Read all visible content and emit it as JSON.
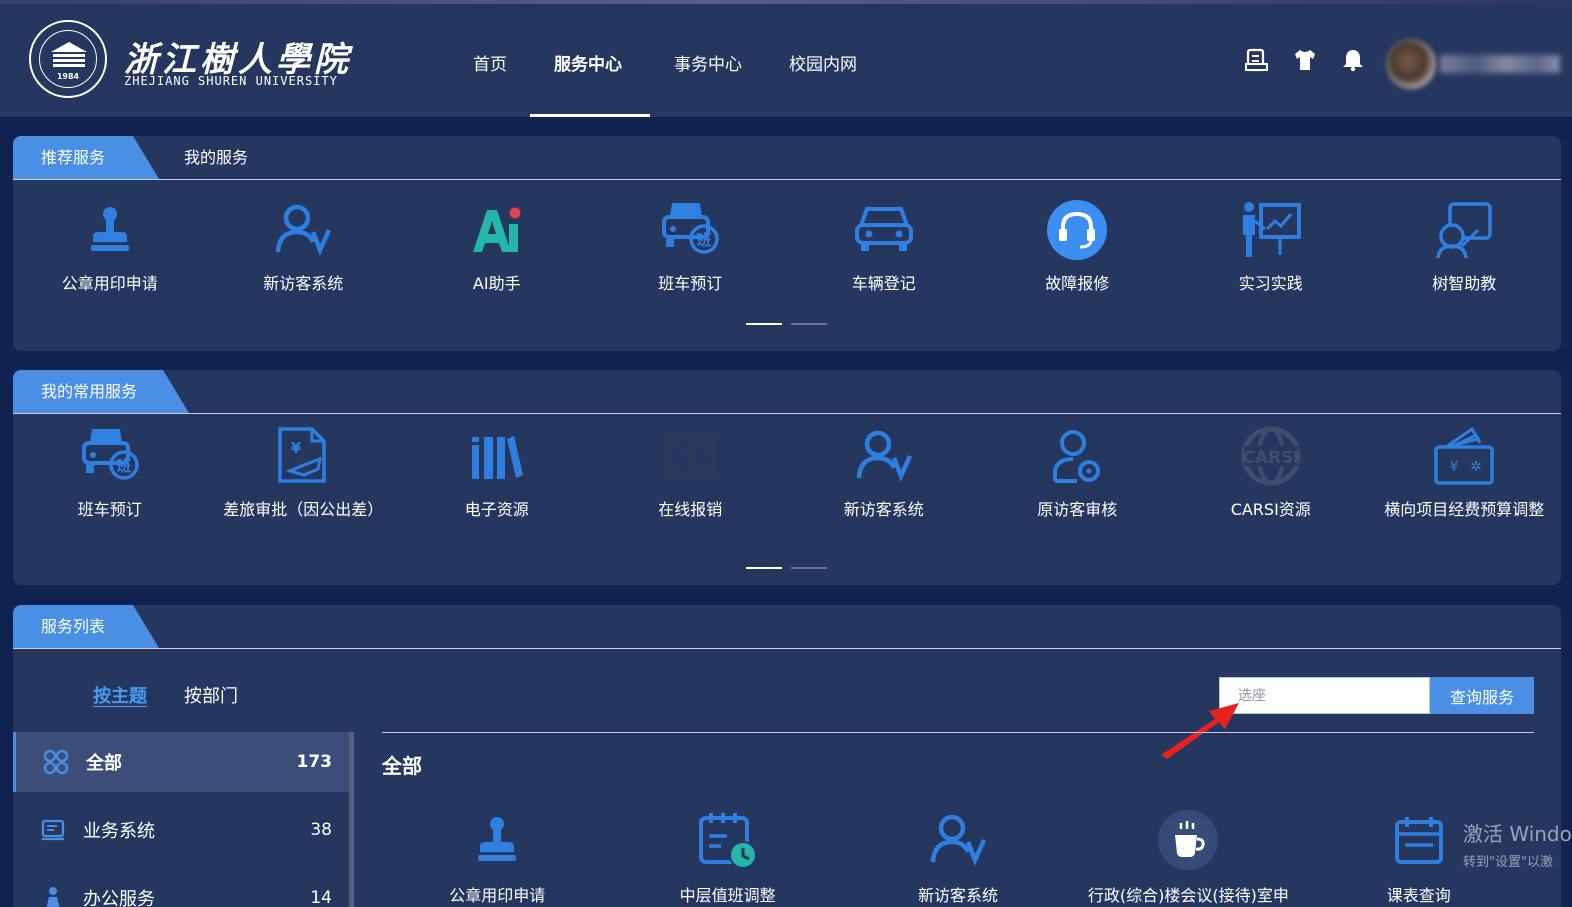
{
  "header": {
    "logo_cn": "浙江樹人學院",
    "logo_en": "ZHEJIANG SHUREN UNIVERSITY",
    "logo_year": "1984",
    "nav": [
      "首页",
      "服务中心",
      "事务中心",
      "校园内网"
    ],
    "active_nav": "服务中心",
    "icons": [
      "clipboard-icon",
      "shirt-icon",
      "bell-icon"
    ]
  },
  "recommended": {
    "tabs": [
      "推荐服务",
      "我的服务"
    ],
    "items": [
      {
        "label": "公章用印申请",
        "icon": "stamp-icon"
      },
      {
        "label": "新访客系统",
        "icon": "visitor-icon"
      },
      {
        "label": "AI助手",
        "icon": "ai-icon"
      },
      {
        "label": "班车预订",
        "icon": "bus-icon"
      },
      {
        "label": "车辆登记",
        "icon": "car-icon"
      },
      {
        "label": "故障报修",
        "icon": "headset-icon"
      },
      {
        "label": "实习实践",
        "icon": "presentation-icon"
      },
      {
        "label": "树智助教",
        "icon": "tutor-icon"
      }
    ]
  },
  "frequent": {
    "tab": "我的常用服务",
    "items": [
      {
        "label": "班车预订",
        "icon": "bus-icon"
      },
      {
        "label": "差旅审批（因公出差）",
        "icon": "travel-approval-icon"
      },
      {
        "label": "电子资源",
        "icon": "books-icon"
      },
      {
        "label": "在线报销",
        "icon": "reimbursement-icon"
      },
      {
        "label": "新访客系统",
        "icon": "visitor-icon"
      },
      {
        "label": "原访客审核",
        "icon": "visitor-review-icon"
      },
      {
        "label": "CARSI资源",
        "icon": "carsi-icon"
      },
      {
        "label": "横向项目经费预算调整",
        "icon": "budget-icon"
      }
    ]
  },
  "service_list": {
    "tab": "服务列表",
    "filters": [
      "按主题",
      "按部门"
    ],
    "active_filter": "按主题",
    "search_placeholder": "选座",
    "search_button": "查询服务",
    "categories": [
      {
        "name": "全部",
        "count": "173",
        "icon": "grid-icon"
      },
      {
        "name": "业务系统",
        "count": "38",
        "icon": "system-icon"
      },
      {
        "name": "办公服务",
        "count": "14",
        "icon": "office-icon"
      }
    ],
    "current_category": "全部",
    "items": [
      {
        "label": "公章用印申请",
        "icon": "stamp-icon"
      },
      {
        "label": "中层值班调整",
        "icon": "duty-calendar-icon"
      },
      {
        "label": "新访客系统",
        "icon": "visitor-icon"
      },
      {
        "label": "行政(综合)楼会议(接待)室申",
        "icon": "coffee-icon"
      },
      {
        "label": "课表查询",
        "icon": "timetable-icon"
      }
    ]
  },
  "watermark": {
    "line1": "激活 Windo",
    "line2": "转到\"设置\"以激"
  },
  "colors": {
    "bg": "#112250",
    "panel": "#26375f",
    "accent": "#4a8fe3",
    "annotation_arrow": "#e8231f"
  }
}
